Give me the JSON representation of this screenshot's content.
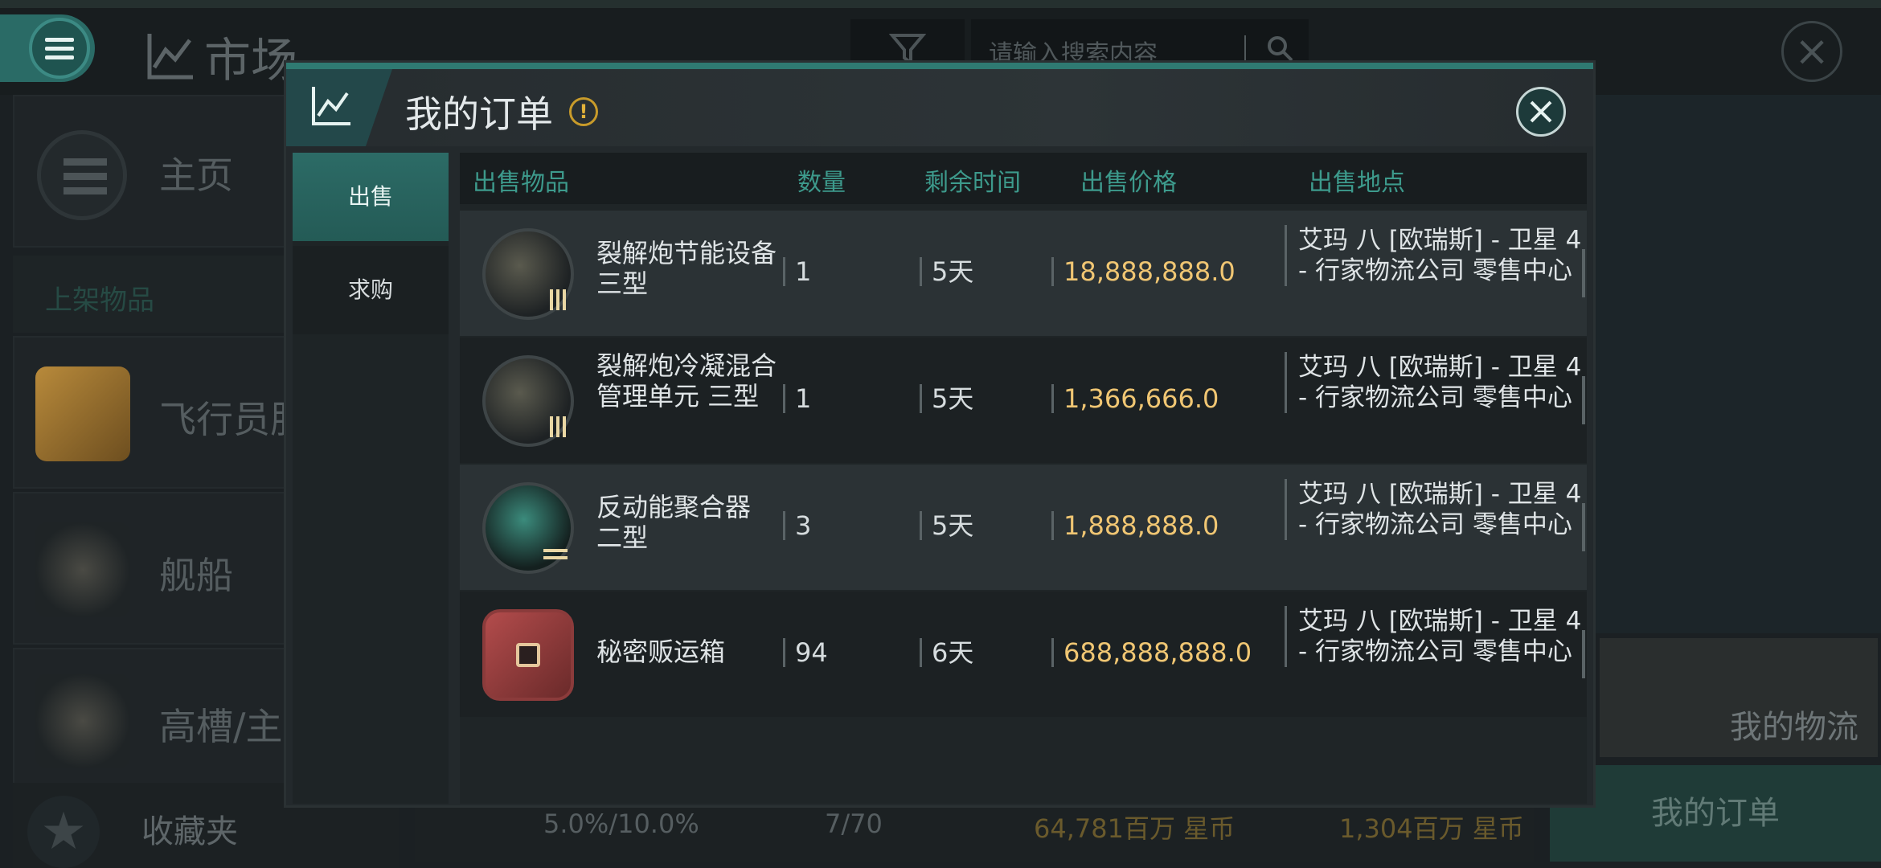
{
  "background": {
    "title": "市场",
    "search_placeholder": "请输入搜索内容",
    "sidebar": {
      "home": "主页",
      "section": "上架物品",
      "items": [
        "飞行员服务",
        "舰船",
        "高槽/主武"
      ],
      "favorites": "收藏夹"
    },
    "bottom_stats": {
      "tax": "5.0%/10.0%",
      "orders": "7/70",
      "wallet": "64,781百万 星币",
      "escrow": "1,304百万 星币"
    },
    "logistics": "我的物流",
    "my_orders_button": "我的订单"
  },
  "modal": {
    "title": "我的订单",
    "tabs": [
      {
        "label": "出售",
        "active": true
      },
      {
        "label": "求购",
        "active": false
      }
    ],
    "columns": {
      "item": "出售物品",
      "qty": "数量",
      "time": "剩余时间",
      "price": "出售价格",
      "location": "出售地点"
    },
    "rows": [
      {
        "name": "裂解炮节能设备 三型",
        "qty": "1",
        "time": "5天",
        "price": "18,888,888.0",
        "location": "艾玛 八 [欧瑞斯] - 卫星 4 - 行家物流公司 零售中心",
        "icon": "weapon-rig-icon"
      },
      {
        "name": "裂解炮冷凝混合管理单元 三型",
        "qty": "1",
        "time": "5天",
        "price": "1,366,666.0",
        "location": "艾玛 八 [欧瑞斯] - 卫星 4 - 行家物流公司 零售中心",
        "icon": "weapon-rig-icon"
      },
      {
        "name": "反动能聚合器 二型",
        "qty": "3",
        "time": "5天",
        "price": "1,888,888.0",
        "location": "艾玛 八 [欧瑞斯] - 卫星 4 - 行家物流公司 零售中心",
        "icon": "shield-module-icon"
      },
      {
        "name": "秘密贩运箱",
        "qty": "94",
        "time": "6天",
        "price": "688,888,888.0",
        "location": "艾玛 八 [欧瑞斯] - 卫星 4 - 行家物流公司 零售中心",
        "icon": "crate-icon"
      }
    ]
  },
  "colors": {
    "accent": "#2f7a72",
    "header_text": "#3d9a8c",
    "price": "#f0c673"
  }
}
